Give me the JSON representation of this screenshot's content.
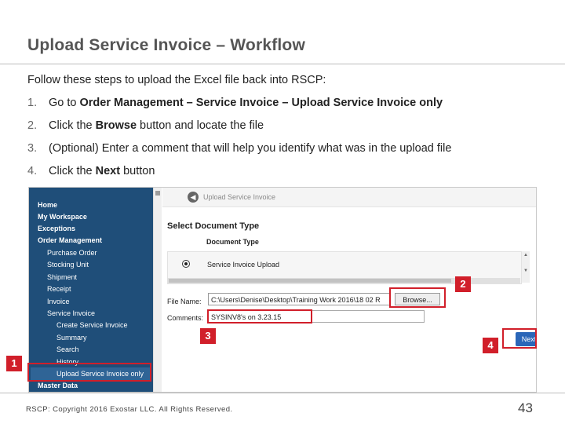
{
  "slide": {
    "title": "Upload Service Invoice – Workflow",
    "intro": "Follow these steps to upload the Excel file back into RSCP:",
    "steps": [
      {
        "num": "1.",
        "pre": "Go to ",
        "bold": "Order Management – Service Invoice – Upload Service Invoice only",
        "post": ""
      },
      {
        "num": "2.",
        "pre": "Click the ",
        "bold": "Browse",
        "post": " button and locate the file"
      },
      {
        "num": "3.",
        "pre": "(Optional) Enter a comment that will help you identify what was in the upload file",
        "bold": "",
        "post": ""
      },
      {
        "num": "4.",
        "pre": "Click the ",
        "bold": "Next",
        "post": " button"
      }
    ],
    "footer": "RSCP: Copyright 2016 Exostar LLC. All Rights Reserved.",
    "page_number": "43"
  },
  "screenshot": {
    "sidebar": {
      "items": [
        {
          "label": "Home"
        },
        {
          "label": "My Workspace"
        },
        {
          "label": "Exceptions"
        },
        {
          "label": "Order Management"
        },
        {
          "label": "Purchase Order"
        },
        {
          "label": "Stocking Unit"
        },
        {
          "label": "Shipment"
        },
        {
          "label": "Receipt"
        },
        {
          "label": "Invoice"
        },
        {
          "label": "Service Invoice"
        },
        {
          "label": "Create Service Invoice"
        },
        {
          "label": "Summary"
        },
        {
          "label": "Search"
        },
        {
          "label": "History"
        },
        {
          "label": "Upload Service Invoice only"
        },
        {
          "label": "Master Data"
        }
      ]
    },
    "page_name": "Upload Service Invoice",
    "back_icon": "◀",
    "section_title": "Select Document Type",
    "doc_type_label": "Document Type",
    "radio_option": "Service Invoice Upload",
    "file_name_label": "File Name:",
    "file_name_value": "C:\\Users\\Denise\\Desktop\\Training Work 2016\\18 02 R",
    "browse_label": "Browse...",
    "comments_label": "Comments:",
    "comments_value": "SYSINV8's on 3.23.15",
    "next_label": "Next"
  },
  "callouts": [
    "1",
    "2",
    "3",
    "4"
  ],
  "colors": {
    "accent_red": "#d11f2a",
    "sidebar_blue": "#1f4e79",
    "button_blue": "#2a66b8"
  }
}
